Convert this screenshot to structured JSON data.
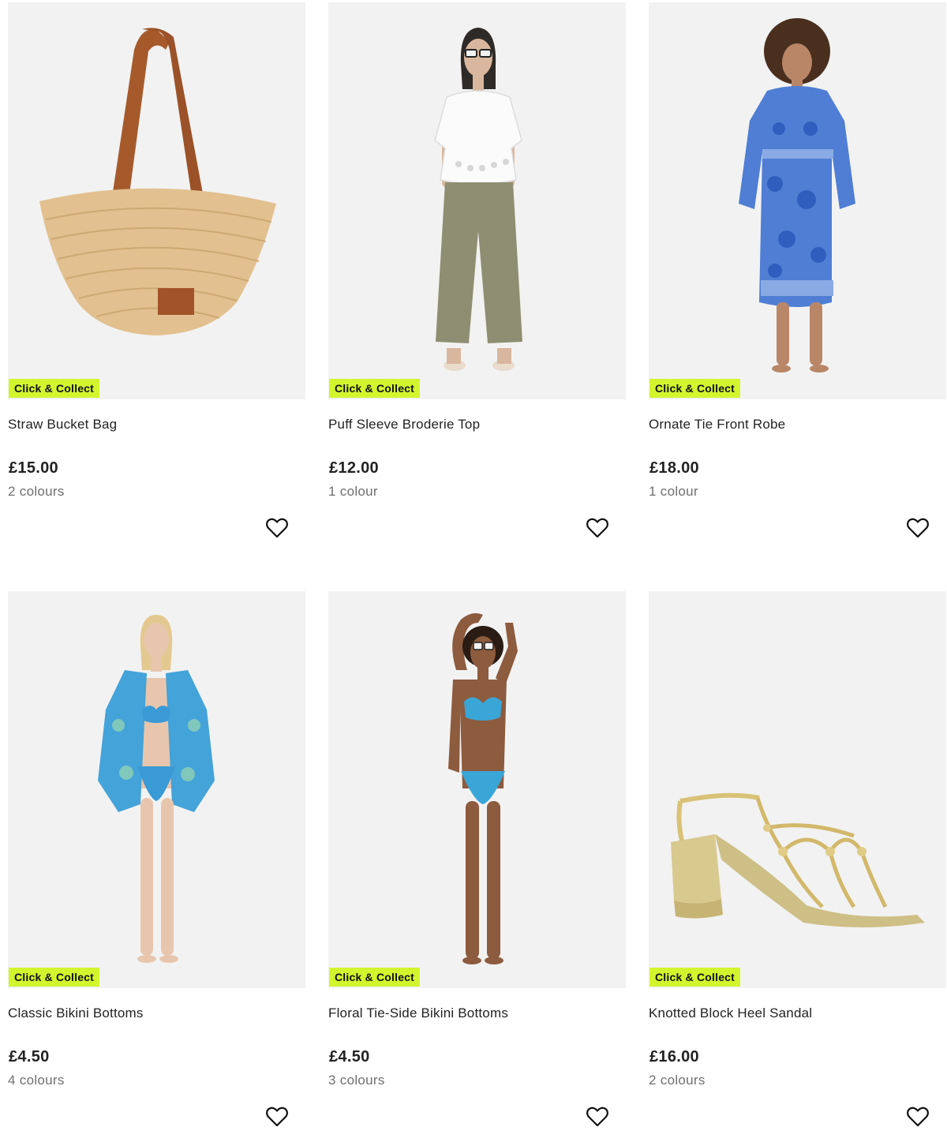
{
  "products": [
    {
      "name": "Straw Bucket Bag",
      "price": "£15.00",
      "colours": "2 colours",
      "badge": "Click & Collect",
      "image_icon": "straw-bag-image"
    },
    {
      "name": "Puff Sleeve Broderie Top",
      "price": "£12.00",
      "colours": "1 colour",
      "badge": "Click & Collect",
      "image_icon": "model-white-top-image"
    },
    {
      "name": "Ornate Tie Front Robe",
      "price": "£18.00",
      "colours": "1 colour",
      "badge": "Click & Collect",
      "image_icon": "model-blue-robe-image"
    },
    {
      "name": "Classic Bikini Bottoms",
      "price": "£4.50",
      "colours": "4 colours",
      "badge": "Click & Collect",
      "image_icon": "model-bikini-shirt-image"
    },
    {
      "name": "Floral Tie-Side Bikini Bottoms",
      "price": "£4.50",
      "colours": "3 colours",
      "badge": "Click & Collect",
      "image_icon": "model-bikini-image"
    },
    {
      "name": "Knotted Block Heel Sandal",
      "price": "£16.00",
      "colours": "2 colours",
      "badge": "Click & Collect",
      "image_icon": "gold-sandal-image"
    }
  ],
  "colors": {
    "badge_bg": "#d2f52e",
    "image_bg": "#f2f2f2",
    "text": "#222222",
    "muted": "#6f6f6f"
  },
  "wishlist_icon": "heart-icon"
}
